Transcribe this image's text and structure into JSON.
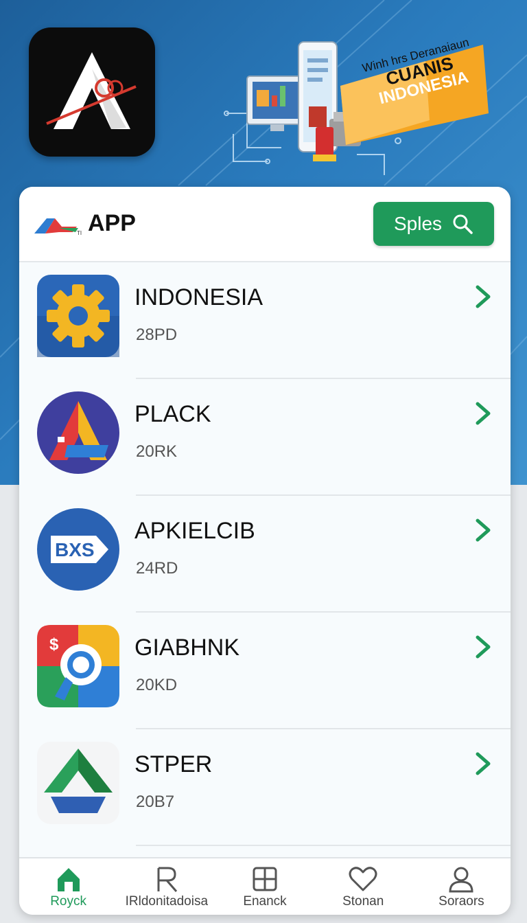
{
  "banner": {
    "line1": "Winh hrs Deranaiaun",
    "line2": "CUANIS",
    "line3": "INDONESIA"
  },
  "header": {
    "brand": "APP",
    "brand_mark_small": "TI",
    "search_label": "Sples"
  },
  "apps": [
    {
      "name": "INDONESIA",
      "sub": "28PD",
      "icon": "gear-icon"
    },
    {
      "name": "PLACK",
      "sub": "20RK",
      "icon": "triangle-logo-icon"
    },
    {
      "name": "APKIELCIB",
      "sub": "24RD",
      "icon_text": "BXS",
      "icon": "bxs-logo-icon"
    },
    {
      "name": "GIABHNK",
      "sub": "20KD",
      "icon_text": "$",
      "icon": "magnifier-logo-icon"
    },
    {
      "name": "STPER",
      "sub": "20B7",
      "icon": "drive-logo-icon"
    }
  ],
  "nav": [
    {
      "label": "Royck",
      "icon": "home-icon",
      "active": true
    },
    {
      "label": "IRldonitadoisa",
      "icon": "r-icon",
      "active": false
    },
    {
      "label": "Enanck",
      "icon": "grid-icon",
      "active": false
    },
    {
      "label": "Stonan",
      "icon": "heart-icon",
      "active": false
    },
    {
      "label": "Soraors",
      "icon": "user-icon",
      "active": false
    }
  ],
  "colors": {
    "accent": "#1f9a5a",
    "hero": "#2a7bbd"
  }
}
